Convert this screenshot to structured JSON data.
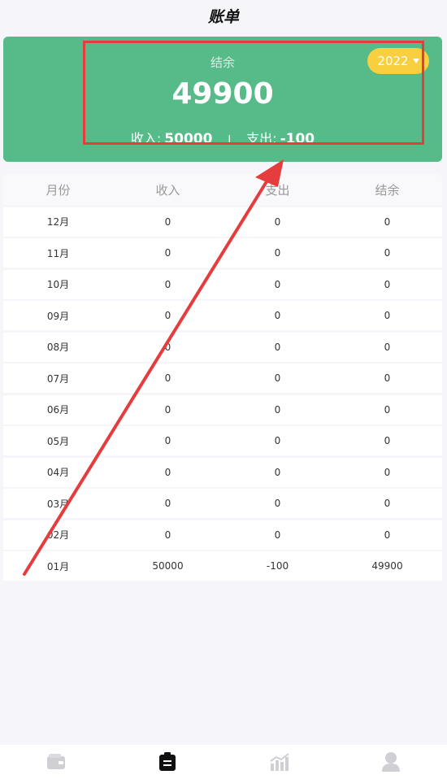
{
  "header": {
    "title": "账单"
  },
  "summary": {
    "balance_label": "结余",
    "balance_value": "49900",
    "income_label": "收入:",
    "income_value": "50000",
    "separator": "I",
    "expense_label": "支出:",
    "expense_value": "-100",
    "year": "2022"
  },
  "table": {
    "headers": [
      "月份",
      "收入",
      "支出",
      "结余"
    ],
    "rows": [
      [
        "12月",
        "0",
        "0",
        "0"
      ],
      [
        "11月",
        "0",
        "0",
        "0"
      ],
      [
        "10月",
        "0",
        "0",
        "0"
      ],
      [
        "09月",
        "0",
        "0",
        "0"
      ],
      [
        "08月",
        "0",
        "0",
        "0"
      ],
      [
        "07月",
        "0",
        "0",
        "0"
      ],
      [
        "06月",
        "0",
        "0",
        "0"
      ],
      [
        "05月",
        "0",
        "0",
        "0"
      ],
      [
        "04月",
        "0",
        "0",
        "0"
      ],
      [
        "03月",
        "0",
        "0",
        "0"
      ],
      [
        "02月",
        "0",
        "0",
        "0"
      ],
      [
        "01月",
        "50000",
        "-100",
        "49900"
      ]
    ]
  },
  "tabbar": {
    "tabs": [
      {
        "icon": "wallet-icon",
        "active": false
      },
      {
        "icon": "clipboard-icon",
        "active": true
      },
      {
        "icon": "chart-icon",
        "active": false
      },
      {
        "icon": "person-icon",
        "active": false
      }
    ]
  },
  "colors": {
    "card": "#56ba89",
    "year_pill": "#f8cf3e",
    "annotation": "#e53d3d",
    "active_tab": "#111111",
    "inactive_tab": "#cfcfd4"
  }
}
